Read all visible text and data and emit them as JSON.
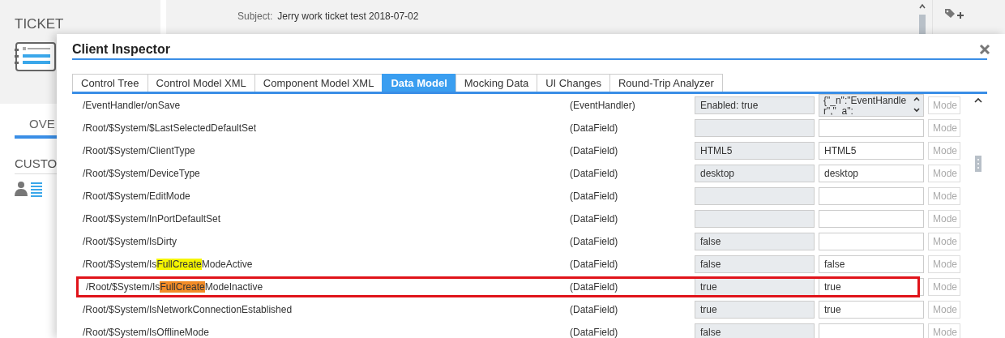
{
  "background": {
    "left_title": "TICKET",
    "subject_label": "Subject:",
    "subject_value": "Jerry work ticket test 2018-07-02",
    "tabs": [
      {
        "label": "OVE",
        "selected": true
      }
    ],
    "section_title": "CUSTO"
  },
  "dialog": {
    "title": "Client Inspector",
    "tabs": [
      {
        "label": "Control Tree",
        "selected": false
      },
      {
        "label": "Control Model XML",
        "selected": false
      },
      {
        "label": "Component Model XML",
        "selected": false
      },
      {
        "label": "Data Model",
        "selected": true
      },
      {
        "label": "Mocking Data",
        "selected": false
      },
      {
        "label": "UI Changes",
        "selected": false
      },
      {
        "label": "Round-Trip Analyzer",
        "selected": false
      }
    ],
    "rows": [
      {
        "kind": "textarea",
        "path": "/EventHandler/onSave",
        "type": "(EventHandler)",
        "value": "Enabled: true",
        "edit": "{\"_n\":\"EventHandler\",\"_a\":",
        "placeholder": "Mode",
        "outlined": false
      },
      {
        "kind": "input",
        "path": "/Root/$System/$LastSelectedDefaultSet",
        "type": "(DataField)",
        "value": "",
        "edit": "",
        "placeholder": "Mode",
        "outlined": false
      },
      {
        "kind": "input",
        "path": "/Root/$System/ClientType",
        "type": "(DataField)",
        "value": "HTML5",
        "edit": "HTML5",
        "placeholder": "Mode",
        "outlined": false
      },
      {
        "kind": "input",
        "path": "/Root/$System/DeviceType",
        "type": "(DataField)",
        "value": "desktop",
        "edit": "desktop",
        "placeholder": "Mode",
        "outlined": false
      },
      {
        "kind": "input",
        "path": "/Root/$System/EditMode",
        "type": "(DataField)",
        "value": "",
        "edit": "",
        "placeholder": "Mode",
        "outlined": false
      },
      {
        "kind": "input",
        "path": "/Root/$System/InPortDefaultSet",
        "type": "(DataField)",
        "value": "",
        "edit": "",
        "placeholder": "Mode",
        "outlined": false
      },
      {
        "kind": "input",
        "path": "/Root/$System/IsDirty",
        "type": "(DataField)",
        "value": "false",
        "edit": "",
        "placeholder": "Mode",
        "outlined": false
      },
      {
        "kind": "input",
        "path": "/Root/$System/Is",
        "path_match": {
          "text": "FullCreate",
          "current": false
        },
        "path_after": "ModeActive",
        "type": "(DataField)",
        "value": "false",
        "edit": "false",
        "placeholder": "Mode",
        "outlined": false
      },
      {
        "kind": "input",
        "path": "/Root/$System/Is",
        "path_match": {
          "text": "FullCreate",
          "current": true
        },
        "path_after": "ModeInactive",
        "type": "(DataField)",
        "value": "true",
        "edit": "true",
        "placeholder": "Mode",
        "outlined": true
      },
      {
        "kind": "input",
        "path": "/Root/$System/IsNetworkConnectionEstablished",
        "type": "(DataField)",
        "value": "true",
        "edit": "true",
        "placeholder": "Mode",
        "outlined": false
      },
      {
        "kind": "input",
        "path": "/Root/$System/IsOfflineMode",
        "type": "(DataField)",
        "value": "false",
        "edit": "",
        "placeholder": "Mode",
        "outlined": false
      }
    ]
  }
}
